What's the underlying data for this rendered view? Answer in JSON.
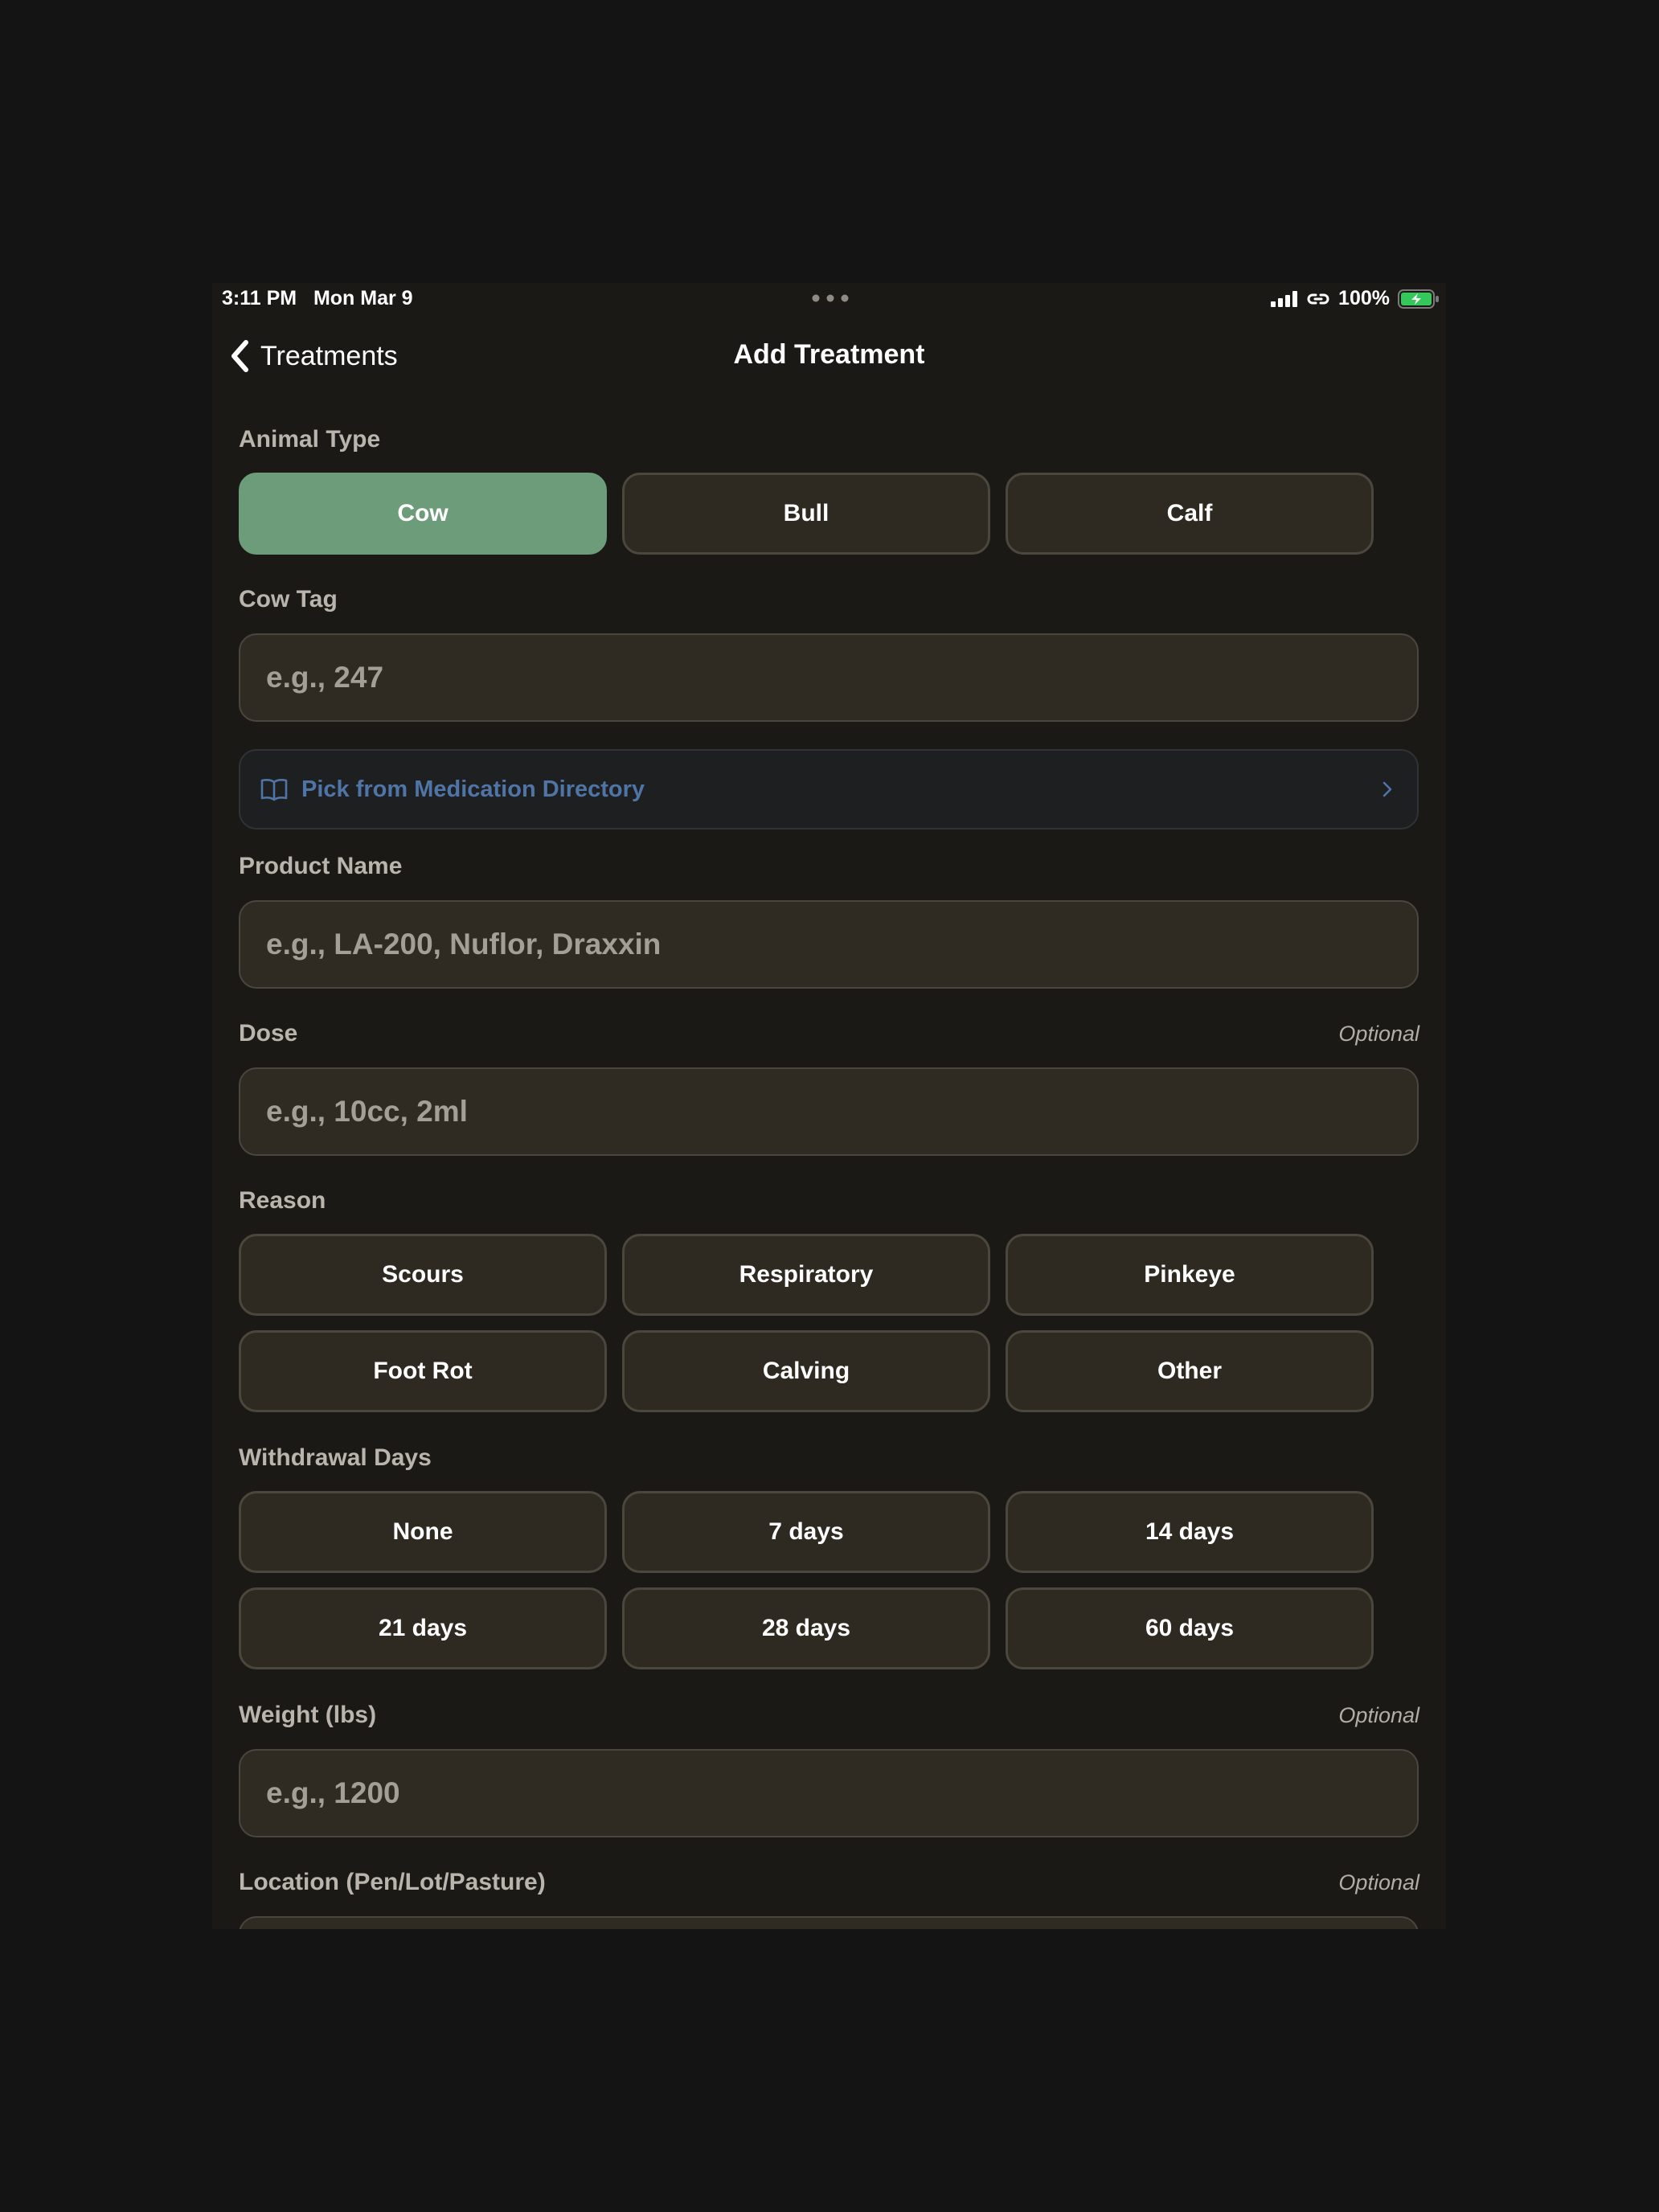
{
  "colors": {
    "background": "#1b1916",
    "accent_selected": "#6c9c7a",
    "link": "#4f74a6",
    "battery": "#34c759"
  },
  "status_bar": {
    "time": "3:11 PM   Mon Mar 9",
    "battery_percent": "100%"
  },
  "nav": {
    "back_label": "Treatments",
    "title": "Add Treatment"
  },
  "form": {
    "animal_type": {
      "label": "Animal Type",
      "options": [
        "Cow",
        "Bull",
        "Calf"
      ],
      "selected": "Cow"
    },
    "cow_tag": {
      "label": "Cow Tag",
      "placeholder": "e.g., 247"
    },
    "directory": {
      "label": "Pick from Medication Directory",
      "icon": "book-open-icon"
    },
    "product_name": {
      "label": "Product Name",
      "placeholder": "e.g., LA-200, Nuflor, Draxxin"
    },
    "dose": {
      "label": "Dose",
      "optional": "Optional",
      "placeholder": "e.g., 10cc, 2ml"
    },
    "reason": {
      "label": "Reason",
      "options": [
        "Scours",
        "Respiratory",
        "Pinkeye",
        "Foot Rot",
        "Calving",
        "Other"
      ]
    },
    "withdrawal_days": {
      "label": "Withdrawal Days",
      "options": [
        "None",
        "7 days",
        "14 days",
        "21 days",
        "28 days",
        "60 days"
      ]
    },
    "weight": {
      "label": "Weight (lbs)",
      "optional": "Optional",
      "placeholder": "e.g., 1200"
    },
    "location": {
      "label": "Location (Pen/Lot/Pasture)",
      "optional": "Optional"
    }
  }
}
